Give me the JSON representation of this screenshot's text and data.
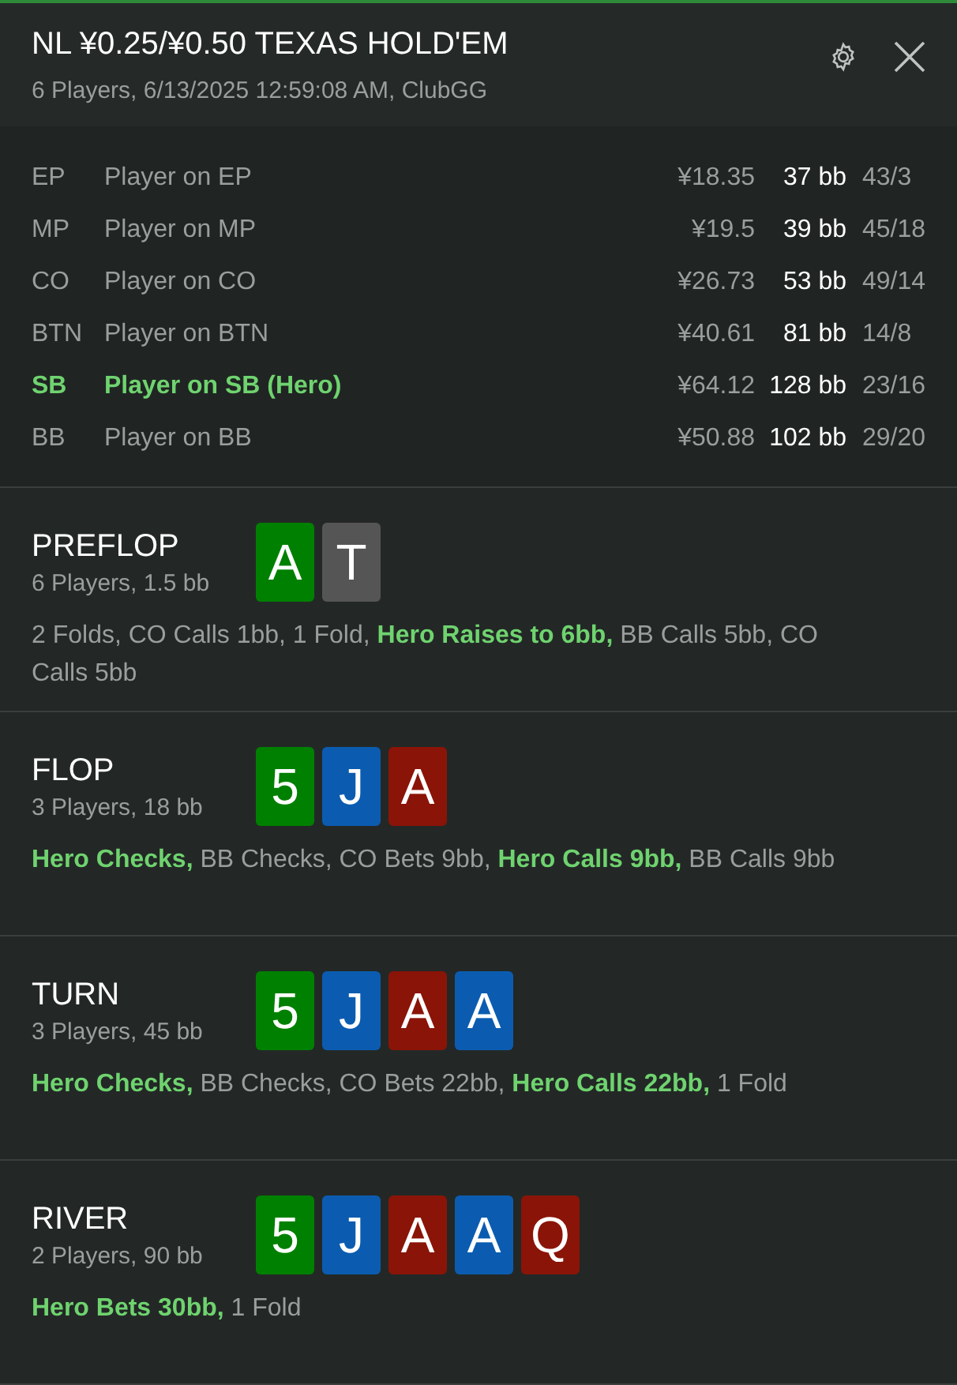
{
  "header": {
    "title": "NL ¥0.25/¥0.50 TEXAS HOLD'EM",
    "subtitle": "6 Players, 6/13/2025 12:59:08 AM, ClubGG"
  },
  "players": [
    {
      "position": "EP",
      "name": "Player on EP",
      "stack": "¥18.35",
      "bb": "37 bb",
      "stats": "43/3",
      "hero": false
    },
    {
      "position": "MP",
      "name": "Player on MP",
      "stack": "¥19.5",
      "bb": "39 bb",
      "stats": "45/18",
      "hero": false
    },
    {
      "position": "CO",
      "name": "Player on CO",
      "stack": "¥26.73",
      "bb": "53 bb",
      "stats": "49/14",
      "hero": false
    },
    {
      "position": "BTN",
      "name": "Player on BTN",
      "stack": "¥40.61",
      "bb": "81 bb",
      "stats": "14/8",
      "hero": false
    },
    {
      "position": "SB",
      "name": "Player on SB (Hero)",
      "stack": "¥64.12",
      "bb": "128 bb",
      "stats": "23/16",
      "hero": true
    },
    {
      "position": "BB",
      "name": "Player on BB",
      "stack": "¥50.88",
      "bb": "102 bb",
      "stats": "29/20",
      "hero": false
    }
  ],
  "streets": [
    {
      "name": "PREFLOP",
      "info": "6 Players, 1.5 bb",
      "cards": [
        {
          "rank": "A",
          "color": "#008000"
        },
        {
          "rank": "T",
          "color": "#555555"
        }
      ],
      "actions": "2 Folds, CO Calls 1bb, 1 Fold, **Hero Raises to 6bb,** BB Calls 5bb, CO Calls 5bb"
    },
    {
      "name": "FLOP",
      "info": "3 Players, 18 bb",
      "cards": [
        {
          "rank": "5",
          "color": "#008000"
        },
        {
          "rank": "J",
          "color": "#0b5cb0"
        },
        {
          "rank": "A",
          "color": "#8a1408"
        }
      ],
      "actions": "**Hero Checks,** BB Checks, CO Bets 9bb, **Hero Calls 9bb,** BB Calls 9bb"
    },
    {
      "name": "TURN",
      "info": "3 Players, 45 bb",
      "cards": [
        {
          "rank": "5",
          "color": "#008000"
        },
        {
          "rank": "J",
          "color": "#0b5cb0"
        },
        {
          "rank": "A",
          "color": "#8a1408"
        },
        {
          "rank": "A",
          "color": "#0b5cb0"
        }
      ],
      "actions": "**Hero Checks,** BB Checks, CO Bets 22bb, **Hero Calls 22bb,** 1 Fold"
    },
    {
      "name": "RIVER",
      "info": "2 Players, 90 bb",
      "cards": [
        {
          "rank": "5",
          "color": "#008000"
        },
        {
          "rank": "J",
          "color": "#0b5cb0"
        },
        {
          "rank": "A",
          "color": "#8a1408"
        },
        {
          "rank": "A",
          "color": "#0b5cb0"
        },
        {
          "rank": "Q",
          "color": "#8a1408"
        }
      ],
      "actions": "**Hero Bets 30bb,** 1 Fold"
    }
  ]
}
